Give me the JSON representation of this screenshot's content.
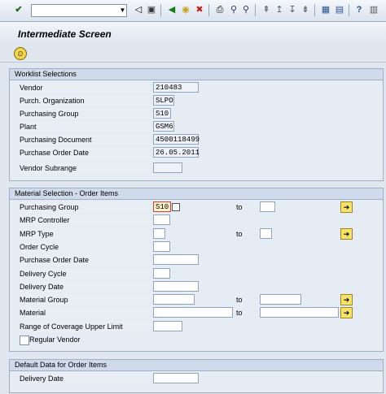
{
  "toolbar": {
    "command_value": "",
    "icons": [
      "check-icon",
      "dropdown-icon",
      "back-icon",
      "save-icon",
      "back-green-icon",
      "exit-icon",
      "cancel-icon",
      "print-icon",
      "find-icon",
      "find-next-icon",
      "first-page-icon",
      "previous-page-icon",
      "next-page-icon",
      "last-page-icon",
      "create-session-icon",
      "shortcut-icon",
      "help-icon"
    ]
  },
  "title": "Intermediate Screen",
  "worklist": {
    "header": "Worklist Selections",
    "vendor_label": "Vendor",
    "vendor_value": "210483",
    "porg_label": "Purch. Organization",
    "porg_value": "SLPO",
    "pgroup_label": "Purchasing Group",
    "pgroup_value": "S10",
    "plant_label": "Plant",
    "plant_value": "GSM6",
    "pdoc_label": "Purchasing Document",
    "pdoc_value": "4500118499",
    "podate_label": "Purchase Order Date",
    "podate_value": "26.05.2011",
    "subrange_label": "Vendor Subrange",
    "subrange_value": ""
  },
  "material": {
    "header": "Material Selection - Order Items",
    "to_label": "to",
    "pgroup_label": "Purchasing Group",
    "pgroup_value": "S10",
    "mrpc_label": "MRP Controller",
    "mrpt_label": "MRP Type",
    "cycle_label": "Order Cycle",
    "podate_label": "Purchase Order Date",
    "dcycle_label": "Delivery Cycle",
    "ddate_label": "Delivery Date",
    "mgroup_label": "Material Group",
    "material_label": "Material",
    "coverage_label": "Range of Coverage Upper Limit",
    "regular_label": "Regular Vendor"
  },
  "defaults": {
    "header": "Default Data for Order Items",
    "ddate_label": "Delivery Date"
  }
}
